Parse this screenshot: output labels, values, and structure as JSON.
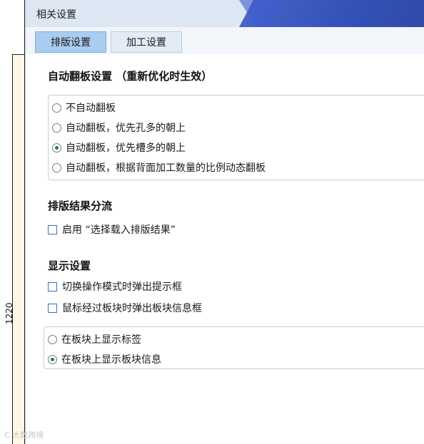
{
  "ruler": {
    "label": "1220"
  },
  "dialog": {
    "title": "相关设置",
    "tabs": [
      {
        "label": "排版设置",
        "active": true
      },
      {
        "label": "加工设置",
        "active": false
      }
    ],
    "flip": {
      "title": "自动翻板设置 （重新优化时生效）",
      "options": [
        {
          "label": "不自动翻板",
          "checked": false
        },
        {
          "label": "自动翻板，优先孔多的朝上",
          "checked": false
        },
        {
          "label": "自动翻板，优先槽多的朝上",
          "checked": true
        },
        {
          "label": "自动翻板，根据背面加工数量的比例动态翻板",
          "checked": false
        }
      ]
    },
    "diversion": {
      "title": "排版结果分流",
      "enable_label": "启用 “选择载入排版结果”",
      "enable_checked": false
    },
    "display": {
      "title": "显示设置",
      "checks": [
        {
          "label": "切换操作模式时弹出提示框",
          "checked": false
        },
        {
          "label": "鼠标经过板块时弹出板块信息框",
          "checked": false
        }
      ],
      "options": [
        {
          "label": "在板块上显示标签",
          "checked": false
        },
        {
          "label": "在板块上显示板块信息",
          "checked": true
        }
      ]
    }
  },
  "watermark": "C 大数跨境"
}
